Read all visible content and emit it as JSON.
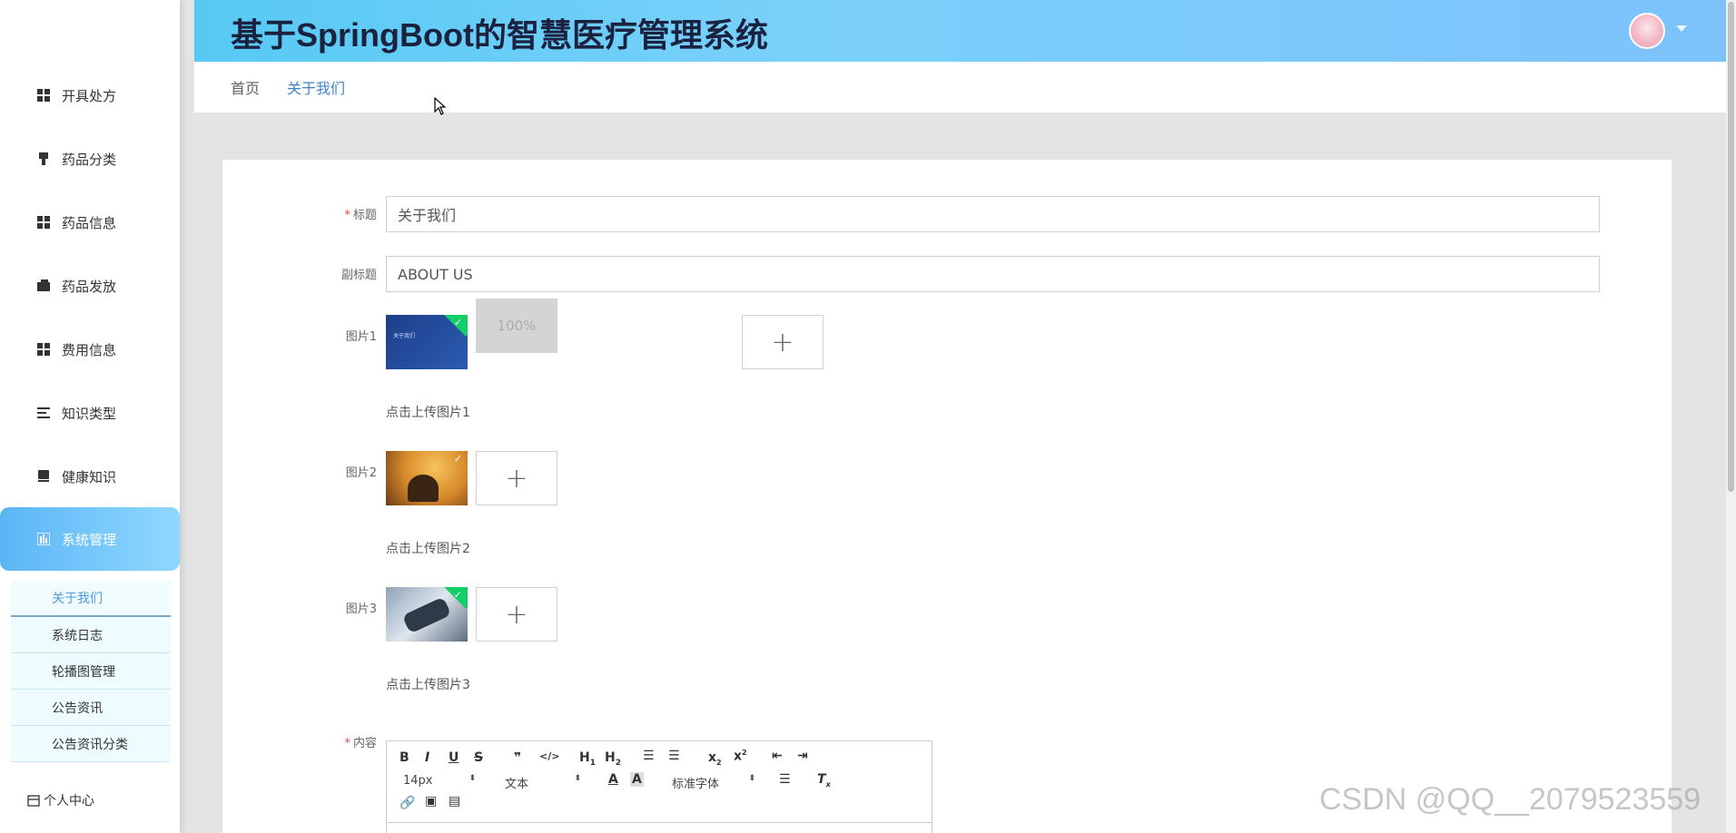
{
  "header": {
    "title": "基于SpringBoot的智慧医疗管理系统"
  },
  "breadcrumb": {
    "home": "首页",
    "current": "关于我们"
  },
  "sidebar": {
    "items": [
      {
        "label": "开具处方",
        "icon": "grid-icon"
      },
      {
        "label": "药品分类",
        "icon": "stamp-icon"
      },
      {
        "label": "药品信息",
        "icon": "grid-icon"
      },
      {
        "label": "药品发放",
        "icon": "wallet-icon"
      },
      {
        "label": "费用信息",
        "icon": "grid-icon"
      },
      {
        "label": "知识类型",
        "icon": "list-icon"
      },
      {
        "label": "健康知识",
        "icon": "book-icon"
      },
      {
        "label": "系统管理",
        "icon": "chart-icon"
      }
    ],
    "submenu": [
      "关于我们",
      "系统日志",
      "轮播图管理",
      "公告资讯",
      "公告资讯分类"
    ],
    "personal": "个人中心"
  },
  "form": {
    "title_label": "标题",
    "title_value": "关于我们",
    "subtitle_label": "副标题",
    "subtitle_value": "ABOUT US",
    "image1_label": "图片1",
    "image1_progress": "100%",
    "image1_hint": "点击上传图片1",
    "image2_label": "图片2",
    "image2_hint": "点击上传图片2",
    "image3_label": "图片3",
    "image3_hint": "点击上传图片3",
    "content_label": "内容",
    "thumb1_text": "关于我们"
  },
  "editor": {
    "font_size": "14px",
    "paragraph": "文本",
    "font_family": "标准字体"
  },
  "watermark": "CSDN @QQ__2079523559",
  "colors": {
    "accent": "#56c9f3",
    "active_link": "#3f84c8",
    "success": "#13ce66",
    "required": "#e24c4c"
  }
}
